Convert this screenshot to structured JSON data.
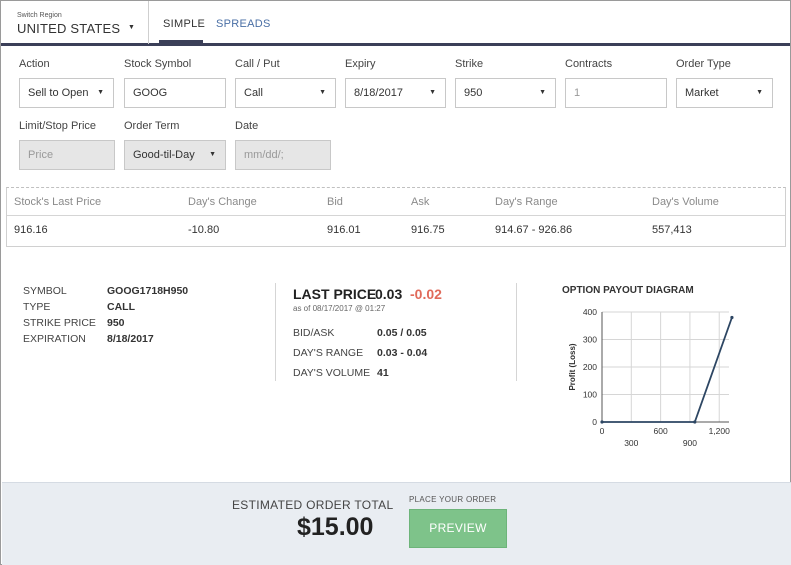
{
  "header": {
    "region_label": "Switch Region",
    "region_value": "UNITED STATES",
    "tabs": [
      "SIMPLE",
      "SPREADS"
    ],
    "active_tab": "SIMPLE",
    "accent_color": "#3b3f58",
    "link_color": "#4a6fa5"
  },
  "form": {
    "action": {
      "label": "Action",
      "value": "Sell to Open"
    },
    "symbol": {
      "label": "Stock Symbol",
      "value": "GOOG"
    },
    "call_put": {
      "label": "Call / Put",
      "value": "Call"
    },
    "expiry": {
      "label": "Expiry",
      "value": "8/18/2017"
    },
    "strike": {
      "label": "Strike",
      "value": "950"
    },
    "contracts": {
      "label": "Contracts",
      "value": "1"
    },
    "order_type": {
      "label": "Order Type",
      "value": "Market"
    },
    "limit_stop": {
      "label": "Limit/Stop Price",
      "placeholder": "Price"
    },
    "order_term": {
      "label": "Order Term",
      "value": "Good-til-Day"
    },
    "date": {
      "label": "Date",
      "placeholder": "mm/dd/;"
    }
  },
  "quote": {
    "headers": [
      "Stock's Last Price",
      "Day's Change",
      "Bid",
      "Ask",
      "Day's Range",
      "Day's Volume"
    ],
    "values": [
      "916.16",
      "-10.80",
      "916.01",
      "916.75",
      "914.67 - 926.86",
      "557,413"
    ]
  },
  "option": {
    "symbol_label": "SYMBOL",
    "symbol": "GOOG1718H950",
    "type_label": "TYPE",
    "type": "CALL",
    "strike_label": "STRIKE PRICE",
    "strike": "950",
    "expiration_label": "EXPIRATION",
    "expiration": "8/18/2017"
  },
  "last_price": {
    "title": "LAST PRICE",
    "value": "0.03",
    "change": "-0.02",
    "change_color": "#e06a5a",
    "as_of": "as of 08/17/2017 @ 01:27",
    "bid_ask_label": "BID/ASK",
    "bid_ask": "0.05 / 0.05",
    "range_label": "DAY'S RANGE",
    "range": "0.03 - 0.04",
    "volume_label": "DAY'S VOLUME",
    "volume": "41"
  },
  "chart_data": {
    "type": "line",
    "title": "OPTION PAYOUT DIAGRAM",
    "ylabel": "Profit (Loss)",
    "xlabel": "",
    "x_ticks_top": [
      "0",
      "900"
    ],
    "x_ticks_bottom": [
      "300",
      "1,200"
    ],
    "x_ticks": [
      0,
      300,
      600,
      900,
      1200
    ],
    "x_tick_labels": [
      "0",
      "300",
      "600",
      "900",
      "1,200"
    ],
    "y_ticks": [
      0,
      100,
      200,
      300,
      400
    ],
    "xlim": [
      0,
      1300
    ],
    "ylim": [
      0,
      400
    ],
    "grid": true,
    "line_color": "#2d4663",
    "series": [
      {
        "x": [
          0,
          950,
          1330
        ],
        "y": [
          0,
          0,
          380
        ]
      }
    ]
  },
  "footer": {
    "estimate_label": "ESTIMATED ORDER TOTAL",
    "estimate_value": "$15.00",
    "place_label": "PLACE YOUR ORDER",
    "preview_label": "PREVIEW",
    "preview_color": "#7ec38a"
  }
}
